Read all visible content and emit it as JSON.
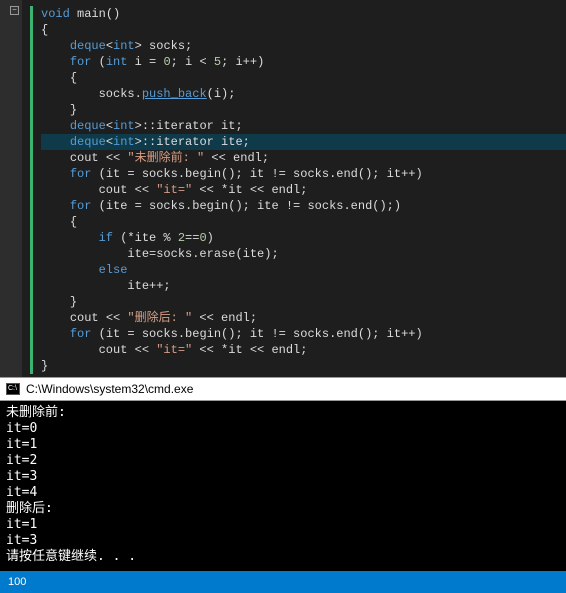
{
  "editor": {
    "fold_glyph": "−",
    "code_lines": [
      {
        "indent": 0,
        "tokens": [
          {
            "t": "void ",
            "c": "kw"
          },
          {
            "t": "main",
            "c": "func"
          },
          {
            "t": "()",
            "c": "punc"
          }
        ]
      },
      {
        "indent": 0,
        "tokens": [
          {
            "t": "{",
            "c": "punc"
          }
        ]
      },
      {
        "indent": 1,
        "tokens": [
          {
            "t": "deque",
            "c": "type"
          },
          {
            "t": "<",
            "c": "punc"
          },
          {
            "t": "int",
            "c": "kw"
          },
          {
            "t": "> socks;",
            "c": "punc"
          }
        ]
      },
      {
        "indent": 1,
        "tokens": [
          {
            "t": "for ",
            "c": "kw"
          },
          {
            "t": "(",
            "c": "punc"
          },
          {
            "t": "int ",
            "c": "kw"
          },
          {
            "t": "i = ",
            "c": "punc"
          },
          {
            "t": "0",
            "c": "num"
          },
          {
            "t": "; i < ",
            "c": "punc"
          },
          {
            "t": "5",
            "c": "num"
          },
          {
            "t": "; i++)",
            "c": "punc"
          }
        ]
      },
      {
        "indent": 1,
        "tokens": [
          {
            "t": "{",
            "c": "punc"
          }
        ]
      },
      {
        "indent": 2,
        "tokens": [
          {
            "t": "socks.",
            "c": "punc"
          },
          {
            "t": "push_back",
            "c": "method-link"
          },
          {
            "t": "(i);",
            "c": "punc"
          }
        ]
      },
      {
        "indent": 1,
        "tokens": [
          {
            "t": "}",
            "c": "punc"
          }
        ]
      },
      {
        "indent": 1,
        "tokens": [
          {
            "t": "deque",
            "c": "type"
          },
          {
            "t": "<",
            "c": "punc"
          },
          {
            "t": "int",
            "c": "kw"
          },
          {
            "t": ">::iterator it;",
            "c": "punc"
          }
        ]
      },
      {
        "indent": 1,
        "hl": true,
        "tokens": [
          {
            "t": "deque",
            "c": "type"
          },
          {
            "t": "<",
            "c": "punc"
          },
          {
            "t": "int",
            "c": "kw"
          },
          {
            "t": ">::iterator ite;",
            "c": "punc"
          }
        ]
      },
      {
        "indent": 1,
        "tokens": [
          {
            "t": "cout << ",
            "c": "punc"
          },
          {
            "t": "\"未删除前: \"",
            "c": "str"
          },
          {
            "t": " << endl;",
            "c": "punc"
          }
        ]
      },
      {
        "indent": 1,
        "tokens": [
          {
            "t": "for ",
            "c": "kw"
          },
          {
            "t": "(it = socks.begin(); it != socks.end(); it++)",
            "c": "punc"
          }
        ]
      },
      {
        "indent": 2,
        "tokens": [
          {
            "t": "cout << ",
            "c": "punc"
          },
          {
            "t": "\"it=\"",
            "c": "str"
          },
          {
            "t": " << *it << endl;",
            "c": "punc"
          }
        ]
      },
      {
        "indent": 1,
        "tokens": [
          {
            "t": "for ",
            "c": "kw"
          },
          {
            "t": "(ite = socks.begin(); ite != socks.end();)",
            "c": "punc"
          }
        ]
      },
      {
        "indent": 1,
        "tokens": [
          {
            "t": "{",
            "c": "punc"
          }
        ]
      },
      {
        "indent": 2,
        "tokens": [
          {
            "t": "if ",
            "c": "kw"
          },
          {
            "t": "(*ite % ",
            "c": "punc"
          },
          {
            "t": "2",
            "c": "num"
          },
          {
            "t": "==",
            "c": "punc"
          },
          {
            "t": "0",
            "c": "num"
          },
          {
            "t": ")",
            "c": "punc"
          }
        ]
      },
      {
        "indent": 3,
        "tokens": [
          {
            "t": "ite=socks.erase(ite);",
            "c": "punc"
          }
        ]
      },
      {
        "indent": 2,
        "tokens": [
          {
            "t": "else",
            "c": "kw"
          }
        ]
      },
      {
        "indent": 3,
        "tokens": [
          {
            "t": "ite++;",
            "c": "punc"
          }
        ]
      },
      {
        "indent": 1,
        "tokens": [
          {
            "t": "}",
            "c": "punc"
          }
        ]
      },
      {
        "indent": 1,
        "tokens": [
          {
            "t": "cout << ",
            "c": "punc"
          },
          {
            "t": "\"删除后: \"",
            "c": "str"
          },
          {
            "t": " << endl;",
            "c": "punc"
          }
        ]
      },
      {
        "indent": 1,
        "tokens": [
          {
            "t": "for ",
            "c": "kw"
          },
          {
            "t": "(it = socks.begin(); it != socks.end(); it++)",
            "c": "punc"
          }
        ]
      },
      {
        "indent": 2,
        "tokens": [
          {
            "t": "cout << ",
            "c": "punc"
          },
          {
            "t": "\"it=\"",
            "c": "str"
          },
          {
            "t": " << *it << endl;",
            "c": "punc"
          }
        ]
      },
      {
        "indent": 0,
        "tokens": [
          {
            "t": "}",
            "c": "punc"
          }
        ]
      }
    ]
  },
  "cmd": {
    "icon_text": "C:\\",
    "title": "C:\\Windows\\system32\\cmd.exe"
  },
  "console_lines": [
    "未删除前:",
    "it=0",
    "it=1",
    "it=2",
    "it=3",
    "it=4",
    "删除后:",
    "it=1",
    "it=3",
    "请按任意键继续. . ."
  ],
  "status": {
    "percent": "100"
  }
}
